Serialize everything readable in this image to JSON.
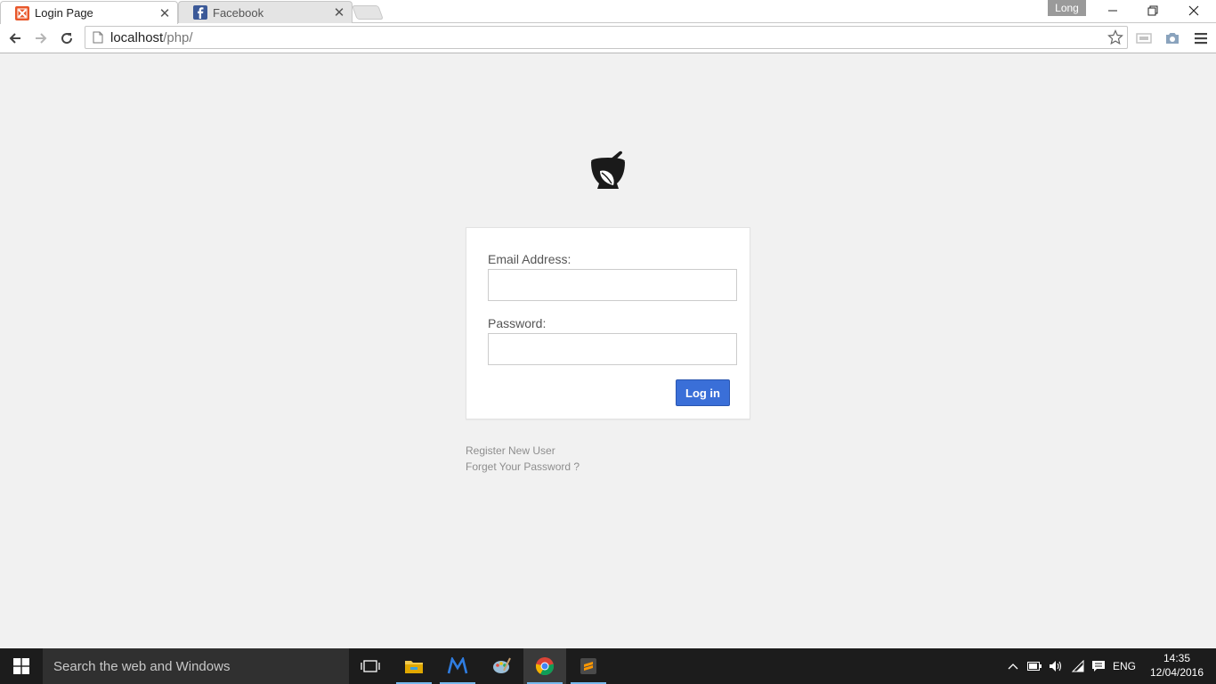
{
  "browser": {
    "tabs": [
      {
        "label": "Login Page",
        "active": true,
        "favicon": "xampp-icon"
      },
      {
        "label": "Facebook",
        "active": false,
        "favicon": "facebook-icon"
      }
    ],
    "profile_name": "Long",
    "url_host": "localhost",
    "url_path": "/php/"
  },
  "login": {
    "email_label": "Email Address:",
    "email_value": "",
    "password_label": "Password:",
    "password_value": "",
    "submit_label": "Log in"
  },
  "links": {
    "register": "Register New User",
    "forgot": "Forget Your Password ?"
  },
  "taskbar": {
    "search_placeholder": "Search the web and Windows",
    "language": "ENG",
    "time": "14:35",
    "date": "12/04/2016"
  },
  "colors": {
    "page_background": "#f1f1f1",
    "primary_button": "#3a6fd8",
    "taskbar": "#1c1c1c"
  }
}
